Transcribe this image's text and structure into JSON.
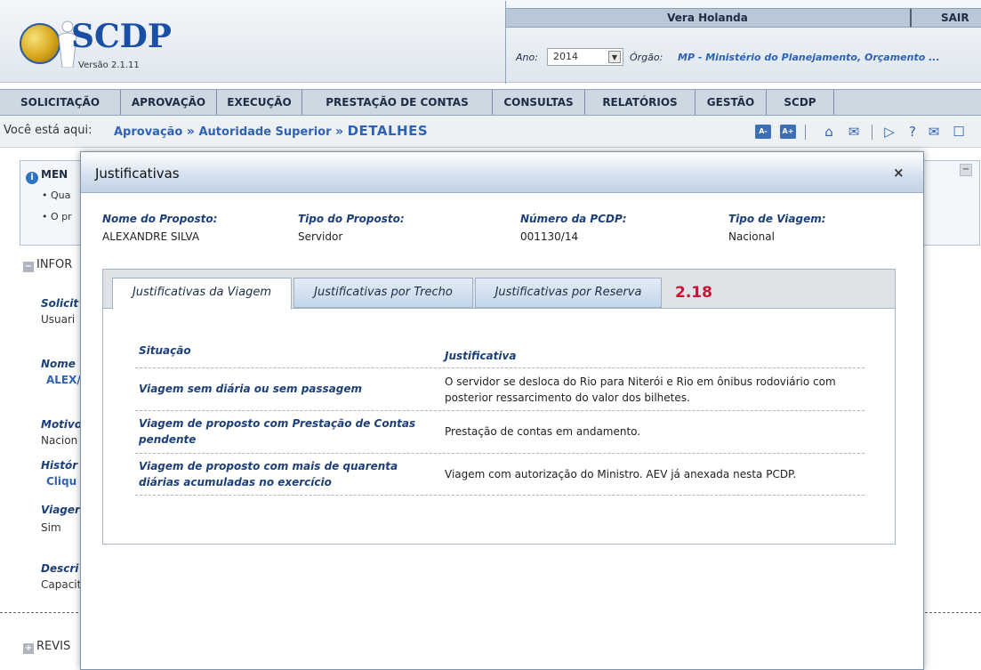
{
  "header": {
    "app_name": "SCDP",
    "version": "Versão 2.1.11",
    "user_name": "Vera Holanda",
    "logout": "SAIR",
    "ano_label": "Ano:",
    "ano_value": "2014",
    "orgao_label": "Órgão:",
    "orgao_value": "MP - Ministério do Planejamento, Orçamento ..."
  },
  "menu": [
    "SOLICITAÇÃO",
    "APROVAÇÃO",
    "EXECUÇÃO",
    "PRESTAÇÃO DE CONTAS",
    "CONSULTAS",
    "RELATÓRIOS",
    "GESTÃO",
    "SCDP"
  ],
  "breadcrumb": {
    "here": "Você está aqui:",
    "items": [
      "Aprovação",
      "Autoridade Superior",
      "DETALHES"
    ]
  },
  "toolbar": {
    "font_decrease": "A-",
    "font_increase": "A+",
    "icons": [
      "home-icon",
      "chat-icon",
      "play-icon",
      "help-icon",
      "mail-icon"
    ]
  },
  "background": {
    "msg_head": "MEN",
    "bullet1": "Qua",
    "bullet2": "O pr",
    "infor": "INFOR",
    "solicit_lbl": "Solicit",
    "solicit_val": "Usuari",
    "nome_lbl": "Nome",
    "nome_val": "ALEX/",
    "motivo_lbl": "Motivo",
    "motivo_val": "Nacion",
    "historico_lbl": "Histór",
    "historico_val": "Cliqu",
    "viagem_lbl": "Viager",
    "viagem_val": "Sim",
    "descr_lbl": "Descri",
    "descr_val": "Capacit",
    "revis": "REVIS"
  },
  "modal": {
    "title": "Justificativas",
    "close": "×",
    "fields": [
      {
        "label": "Nome do Proposto:",
        "value": "ALEXANDRE SILVA"
      },
      {
        "label": "Tipo do Proposto:",
        "value": "Servidor"
      },
      {
        "label": "Número da PCDP:",
        "value": "001130/14"
      },
      {
        "label": "Tipo de Viagem:",
        "value": "Nacional"
      }
    ],
    "tabs": [
      "Justificativas da Viagem",
      "Justificativas por Trecho",
      "Justificativas por Reserva"
    ],
    "version_tag": "2.18",
    "table": {
      "headers": [
        "Situação",
        "Justificativa"
      ],
      "rows": [
        {
          "situacao": "Viagem sem diária ou sem passagem",
          "justificativa": "O servidor se desloca do Rio para Niterói e Rio em ônibus rodoviário com posterior ressarcimento do valor dos bilhetes."
        },
        {
          "situacao": "Viagem de proposto com Prestação de Contas pendente",
          "justificativa": "Prestação de contas em andamento."
        },
        {
          "situacao": "Viagem de proposto com mais de quarenta diárias acumuladas no exercício",
          "justificativa": "Viagem com autorização do Ministro. AEV já anexada nesta PCDP."
        }
      ]
    }
  }
}
